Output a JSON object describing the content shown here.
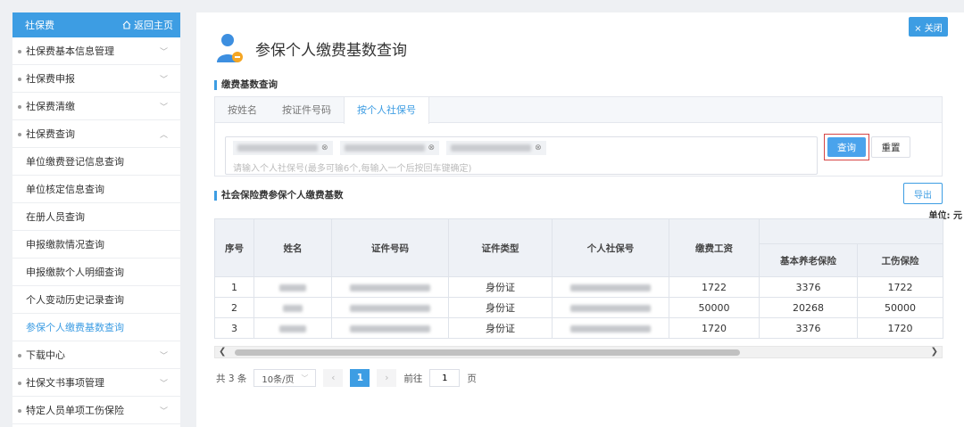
{
  "sidebar": {
    "title": "社保费",
    "home_label": "返回主页",
    "items": [
      {
        "label": "社保费基本信息管理"
      },
      {
        "label": "社保费申报"
      },
      {
        "label": "社保费清缴"
      },
      {
        "label": "社保费查询"
      }
    ],
    "subitems": [
      {
        "label": "单位缴费登记信息查询"
      },
      {
        "label": "单位核定信息查询"
      },
      {
        "label": "在册人员查询"
      },
      {
        "label": "申报缴款情况查询"
      },
      {
        "label": "申报缴款个人明细查询"
      },
      {
        "label": "个人变动历史记录查询"
      },
      {
        "label": "参保个人缴费基数查询"
      }
    ],
    "tail_items": [
      {
        "label": "下载中心"
      },
      {
        "label": "社保文书事项管理"
      },
      {
        "label": "特定人员单项工伤保险"
      }
    ]
  },
  "header": {
    "title": "参保个人缴费基数查询",
    "close_label": "× 关闭"
  },
  "search": {
    "section_title": "缴费基数查询",
    "tabs": [
      "按姓名",
      "按证件号码",
      "按个人社保号"
    ],
    "active_tab": 2,
    "tag_count": 3,
    "placeholder": "请输入个人社保号(最多可输6个,每输入一个后按回车键确定)",
    "query_label": "查询",
    "reset_label": "重置"
  },
  "results": {
    "section_title": "社会保险费参保个人缴费基数",
    "export_label": "导出",
    "unit_label": "单位: 元",
    "headers": {
      "seq": "序号",
      "name": "姓名",
      "id_no": "证件号码",
      "id_type": "证件类型",
      "ss_no": "个人社保号",
      "wage": "缴费工资",
      "pension": "基本养老保险",
      "injury": "工伤保险"
    },
    "rows": [
      {
        "seq": "1",
        "id_type": "身份证",
        "wage": "1722",
        "pension": "3376",
        "injury": "1722"
      },
      {
        "seq": "2",
        "id_type": "身份证",
        "wage": "50000",
        "pension": "20268",
        "injury": "50000"
      },
      {
        "seq": "3",
        "id_type": "身份证",
        "wage": "1720",
        "pension": "3376",
        "injury": "1720"
      }
    ]
  },
  "pagination": {
    "total": "共 3 条",
    "page_size": "10条/页",
    "current_page": "1",
    "goto_label": "前往",
    "goto_value": "1",
    "page_suffix": "页"
  },
  "colors": {
    "accent": "#3d9de3",
    "highlight_border": "#d64545"
  },
  "icons": {
    "home": "home-icon",
    "chevron": "chevron-down-icon",
    "title": "person-icon",
    "tag_close": "close-icon"
  }
}
